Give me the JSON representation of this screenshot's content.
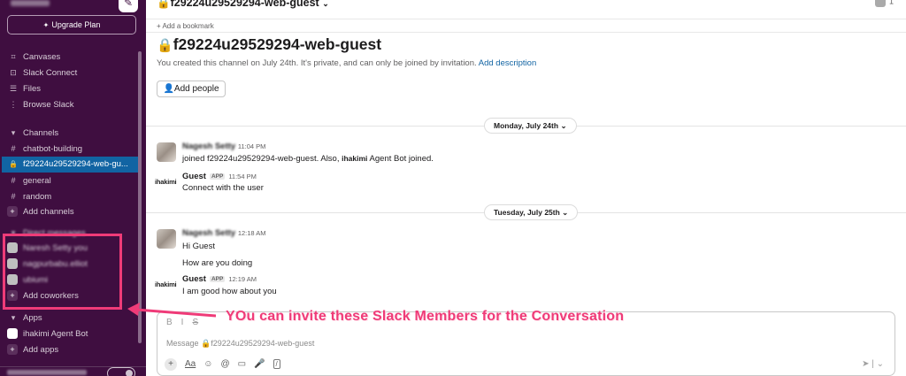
{
  "sidebar": {
    "compose_icon": "✎",
    "upgrade_label": "Upgrade Plan",
    "nav": [
      {
        "icon": "canvases-icon",
        "glyph": "⌗",
        "label": "Canvases"
      },
      {
        "icon": "slack-connect-icon",
        "glyph": "⊡",
        "label": "Slack Connect"
      },
      {
        "icon": "files-icon",
        "glyph": "☰",
        "label": "Files"
      },
      {
        "icon": "more-icon",
        "glyph": "⋮",
        "label": "Browse Slack"
      }
    ],
    "channels_header": "Channels",
    "channels": [
      {
        "label": "chatbot-building",
        "glyph": "#"
      },
      {
        "label": "f29224u29529294-web-gu...",
        "glyph": "🔒",
        "active": true
      },
      {
        "label": "general",
        "glyph": "#"
      },
      {
        "label": "random",
        "glyph": "#"
      }
    ],
    "add_channels": "Add channels",
    "dm_header": "Direct messages",
    "dms": [
      "Naresh Setty  you",
      "nagpurbabu.elliot",
      "ubiumi"
    ],
    "add_coworkers": "Add coworkers",
    "apps_header": "Apps",
    "apps": [
      "ihakimi Agent Bot"
    ],
    "add_apps": "Add apps"
  },
  "annotation": {
    "text": "YOu can invite these Slack Members for the Conversation",
    "color": "#ef3b78"
  },
  "header": {
    "channel_name": "f29224u29529294-web-guest",
    "member_count": "1",
    "bookmark_label": "+ Add a bookmark"
  },
  "intro": {
    "title": "f29224u29529294-web-guest",
    "description": "You created this channel on July 24th. It's private, and can only be joined by invitation.",
    "add_description": "Add description",
    "add_people": "Add people"
  },
  "dividers": {
    "first": "Monday, July 24th",
    "second": "Tuesday, July 25th"
  },
  "messages": [
    {
      "name": "Nagesh Setty",
      "time": "11:04 PM",
      "text_before": "joined f29224u29529294-web-guest. Also,",
      "bold": "ihakimi",
      "text_after": "Agent Bot joined."
    },
    {
      "name": "Guest",
      "badge": "APP",
      "time": "11:54 PM",
      "text": "Connect with the user",
      "logo": "ihakimi"
    },
    {
      "name": "Nagesh Setty",
      "time": "12:18 AM",
      "texts": [
        "Hi Guest",
        "How are you doing"
      ]
    },
    {
      "name": "Guest",
      "badge": "APP",
      "time": "12:19 AM",
      "text": "I am good how about you",
      "logo": "ihakimi"
    }
  ],
  "composer": {
    "placeholder": "Message 🔒f29224u29529294-web-guest",
    "format_buttons": [
      "B",
      "I",
      "S"
    ],
    "tools": [
      "Aa",
      "☺",
      "@",
      "▭",
      "🎤",
      "/"
    ]
  },
  "colors": {
    "sidebar_bg": "#3f0e40",
    "active_channel": "#1164a3",
    "link": "#1264a3"
  }
}
